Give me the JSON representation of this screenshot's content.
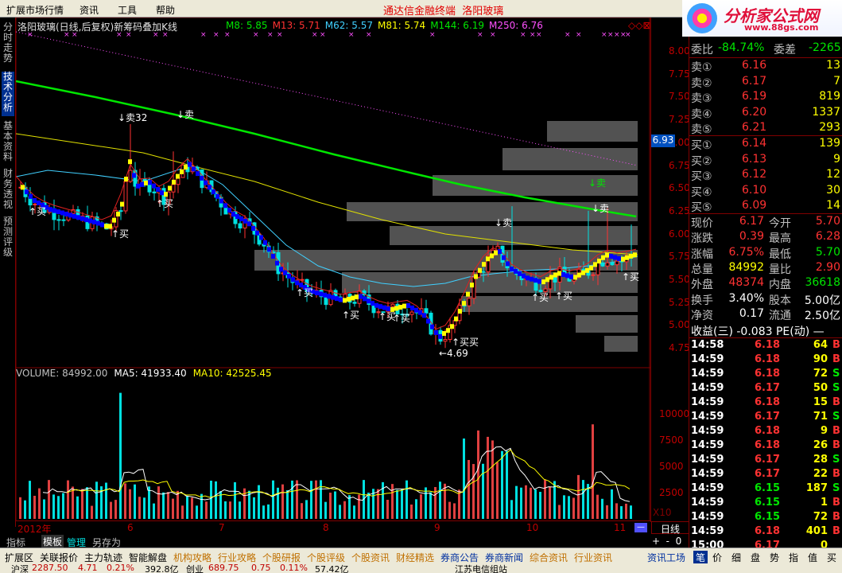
{
  "menu": [
    "扩展市场行情",
    "资讯",
    "工具",
    "帮助"
  ],
  "app_title": "通达信金融终端",
  "stock_name_title": "洛阳玻璃",
  "logo": {
    "text": "分析家公式网",
    "url": "www.88gs.com"
  },
  "left_tabs": [
    "分时走势",
    "技术分析",
    "基本资料",
    "财务透视",
    "预测评级"
  ],
  "chart_header": {
    "name": "洛阳玻璃(日线,后复权)新筹码叠加K线",
    "mas": [
      {
        "label": "M8: 5.85",
        "color": "#00e600"
      },
      {
        "label": "M13: 5.71",
        "color": "#ff3232"
      },
      {
        "label": "M62: 5.57",
        "color": "#40d0ff"
      },
      {
        "label": "M81: 5.74",
        "color": "#ffff00"
      },
      {
        "label": "M144: 6.19",
        "color": "#00e600"
      },
      {
        "label": "M250: 6.76",
        "color": "#ff50ff"
      }
    ]
  },
  "price_axis": [
    "8.00",
    "7.75",
    "7.50",
    "7.25",
    "7.00",
    "6.75",
    "6.50",
    "6.25",
    "6.00",
    "5.75",
    "5.50",
    "5.25",
    "5.00",
    "4.75"
  ],
  "price_tag": "6.93",
  "volume_axis": [
    "10000",
    "7500",
    "5000",
    "2500"
  ],
  "volume_axis_label": "X10",
  "volume_header": [
    {
      "label": "VOLUME: 84992.00",
      "color": "#c0c0c0"
    },
    {
      "label": "MA5: 41933.40",
      "color": "#ffffff"
    },
    {
      "label": "MA10: 42525.45",
      "color": "#ffff00"
    }
  ],
  "annotations": {
    "sell": [
      "↓卖32",
      "↓卖",
      "↓卖",
      "↓卖",
      "↓卖"
    ],
    "buy": [
      "↑买",
      "↑买",
      "↑买",
      "↑买",
      "↑买",
      "↑买",
      "↑买",
      "↑买",
      "↑买",
      "↑买买",
      "↑买"
    ],
    "low": "←4.69"
  },
  "date_axis": [
    "2012年",
    "6",
    "7",
    "8",
    "9",
    "10",
    "11"
  ],
  "period_label": "日线",
  "bottom_tabs": [
    "指标",
    "模板",
    "管理",
    "另存为"
  ],
  "quote": {
    "ratio": {
      "label": "委比",
      "value": "-84.74%",
      "diff_label": "委差",
      "diff": "-2265"
    },
    "sells": [
      {
        "label": "卖⑤",
        "price": "6.21",
        "vol": "293"
      },
      {
        "label": "卖④",
        "price": "6.20",
        "vol": "1337"
      },
      {
        "label": "卖③",
        "price": "6.19",
        "vol": "819"
      },
      {
        "label": "卖②",
        "price": "6.17",
        "vol": "7"
      },
      {
        "label": "卖①",
        "price": "6.16",
        "vol": "13"
      }
    ],
    "buys": [
      {
        "label": "买①",
        "price": "6.14",
        "vol": "139"
      },
      {
        "label": "买②",
        "price": "6.13",
        "vol": "9"
      },
      {
        "label": "买③",
        "price": "6.12",
        "vol": "12"
      },
      {
        "label": "买④",
        "price": "6.10",
        "vol": "30"
      },
      {
        "label": "买⑤",
        "price": "6.09",
        "vol": "14"
      }
    ],
    "stats": [
      {
        "l1": "现价",
        "v1": "6.17",
        "l2": "今开",
        "v2": "5.70"
      },
      {
        "l1": "涨跌",
        "v1": "0.39",
        "l2": "最高",
        "v2": "6.28"
      },
      {
        "l1": "涨幅",
        "v1": "6.75%",
        "l2": "最低",
        "v2": "5.70"
      },
      {
        "l1": "总量",
        "v1": "84992",
        "l2": "量比",
        "v2": "2.90"
      },
      {
        "l1": "外盘",
        "v1": "48374",
        "l2": "内盘",
        "v2": "36618"
      },
      {
        "l1": "换手",
        "v1": "3.40%",
        "l2": "股本",
        "v2": "5.00亿"
      },
      {
        "l1": "净资",
        "v1": "0.17",
        "l2": "流通",
        "v2": "2.50亿"
      }
    ],
    "eps": "收益(三) -0.083 PE(动) —"
  },
  "ticks": [
    {
      "t": "14:58",
      "p": "6.18",
      "v": "64",
      "d": "B"
    },
    {
      "t": "14:59",
      "p": "6.18",
      "v": "90",
      "d": "B"
    },
    {
      "t": "14:59",
      "p": "6.18",
      "v": "72",
      "d": "S"
    },
    {
      "t": "14:59",
      "p": "6.17",
      "v": "50",
      "d": "S"
    },
    {
      "t": "14:59",
      "p": "6.18",
      "v": "15",
      "d": "B"
    },
    {
      "t": "14:59",
      "p": "6.17",
      "v": "71",
      "d": "S"
    },
    {
      "t": "14:59",
      "p": "6.18",
      "v": "9",
      "d": "B"
    },
    {
      "t": "14:59",
      "p": "6.18",
      "v": "26",
      "d": "B"
    },
    {
      "t": "14:59",
      "p": "6.17",
      "v": "28",
      "d": "S"
    },
    {
      "t": "14:59",
      "p": "6.17",
      "v": "22",
      "d": "B"
    },
    {
      "t": "14:59",
      "p": "6.15",
      "v": "187",
      "d": "S"
    },
    {
      "t": "14:59",
      "p": "6.15",
      "v": "1",
      "d": "B"
    },
    {
      "t": "14:59",
      "p": "6.15",
      "v": "72",
      "d": "B"
    },
    {
      "t": "14:59",
      "p": "6.18",
      "v": "401",
      "d": "B"
    },
    {
      "t": "15:00",
      "p": "6.17",
      "v": "0",
      "d": ""
    }
  ],
  "status_tabs": [
    "扩展区",
    "关联报价",
    "主力轨迹",
    "智能解盘",
    "机构攻略",
    "行业攻略",
    "个股研报",
    "个股评级",
    "个股资讯",
    "财经精选",
    "券商公告",
    "券商新闻",
    "综合资讯",
    "行业资讯",
    "资讯工场"
  ],
  "right_tabs": [
    "笔",
    "价",
    "细",
    "盘",
    "势",
    "指",
    "值",
    "买"
  ],
  "ticker": {
    "index": "沪深",
    "value": "2287.50",
    "change": "4.71",
    "pct": "0.21%",
    "amount": "392.8亿",
    "index2": "创业",
    "value2": "689.75",
    "change2": "0.75",
    "pct2": "0.11%",
    "amount2": "57.42亿",
    "broker": "江苏电信组站"
  },
  "colors": {
    "up": "#ff3232",
    "down": "#00e0e0",
    "ma144": "#00e600",
    "ma250": "#ff50ff",
    "yellow": "#ffff00",
    "blue": "#0000ff"
  }
}
